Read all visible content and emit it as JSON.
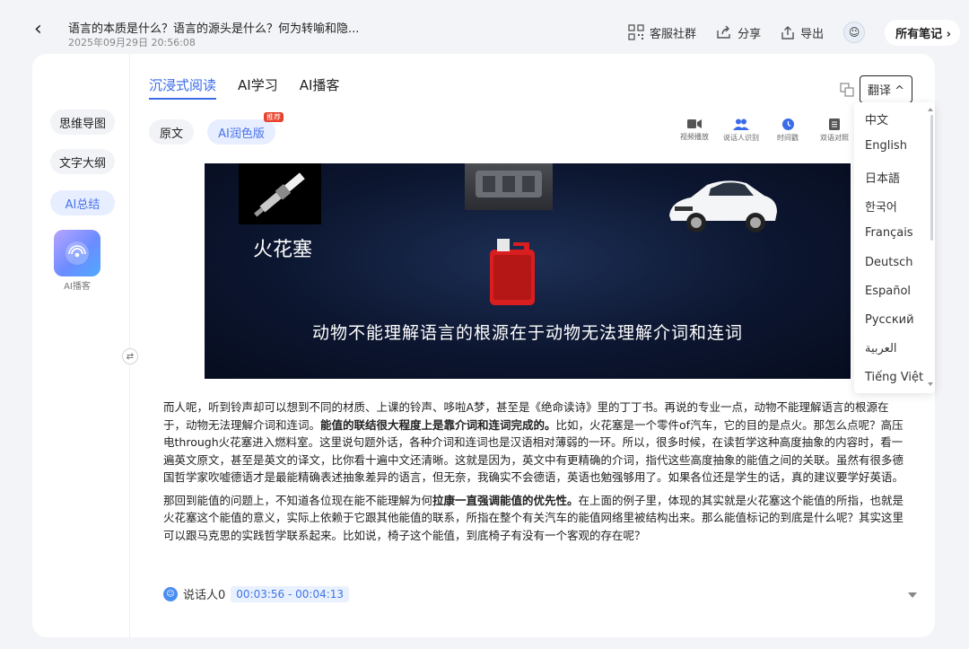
{
  "header": {
    "title": "语言的本质是什么？语言的源头是什么？何为转喻和隐...",
    "datetime": "2025年09月29日 20:56:08",
    "actions": {
      "community": "客服社群",
      "share": "分享",
      "export": "导出",
      "all_notes": "所有笔记"
    }
  },
  "sidebar": {
    "items": [
      {
        "label": "思维导图"
      },
      {
        "label": "文字大纲"
      },
      {
        "label": "AI总结"
      }
    ],
    "podcast_label": "AI播客"
  },
  "tabs": [
    {
      "label": "沉浸式阅读"
    },
    {
      "label": "AI学习"
    },
    {
      "label": "AI播客"
    }
  ],
  "translate_label": "翻译 ^",
  "versions": {
    "original": "原文",
    "polished": "AI润色版",
    "badge": "推荐"
  },
  "tools": [
    {
      "label": "视频播放"
    },
    {
      "label": "说话人识别"
    },
    {
      "label": "时间戳"
    },
    {
      "label": "双语对照"
    }
  ],
  "video": {
    "spark_plug_word": "火花塞",
    "subtitle": "动物不能理解语言的根源在于动物无法理解介词和连词"
  },
  "content": {
    "p1_a": "而人呢，听到铃声却可以想到不同的材质、上课的铃声、哆啦A梦，甚至是《绝命读诗》里的丁丁书。再说的专业一点，动物不能理解语言的根源在于，动物无法理解介词和连词。",
    "p1_b": "能值的联结很大程度上是靠介词和连词完成的。",
    "p1_c": "比如，火花塞是一个零件of汽车，它的目的是点火。那怎么点呢？高压电through火花塞进入燃料室。这里说句题外话，各种介词和连词也是汉语相对薄弱的一环。所以，很多时候，在读哲学这种高度抽象的内容时，看一遍英文原文，甚至是英文的译文，比你看十遍中文还清晰。这就是因为，英文中有更精确的介词，指代这些高度抽象的能值之间的关联。虽然有很多德国哲学家吹嘘德语才是最能精确表述抽象差异的语言，但无奈，我确实不会德语，英语也勉强够用了。如果各位还是学生的话，真的建议要学好英语。",
    "p2_a": "那回到能值的问题上，不知道各位现在能不能理解为何",
    "p2_b": "拉康一直强调能值的优先性。",
    "p2_c": "在上面的例子里，体现的其实就是火花塞这个能值的所指，也就是火花塞这个能值的意义，实际上依赖于它跟其他能值的联系，所指在整个有关汽车的能值网络里被结构出来。那么能值标记的到底是什么呢？其实这里可以跟马克思的实践哲学联系起来。比如说，椅子这个能值，到底椅子有没有一个客观的存在呢？"
  },
  "speaker": {
    "name": "说话人0",
    "time_range": "00:03:56 - 00:04:13"
  },
  "languages": [
    "中文",
    "English",
    "日本語",
    "한국어",
    "Français",
    "Deutsch",
    "Español",
    "Русский",
    "العربية",
    "Tiếng Việt"
  ],
  "colors": {
    "accent": "#3a6be8",
    "badge": "#e8412c",
    "video_bg": "#0c1630"
  }
}
